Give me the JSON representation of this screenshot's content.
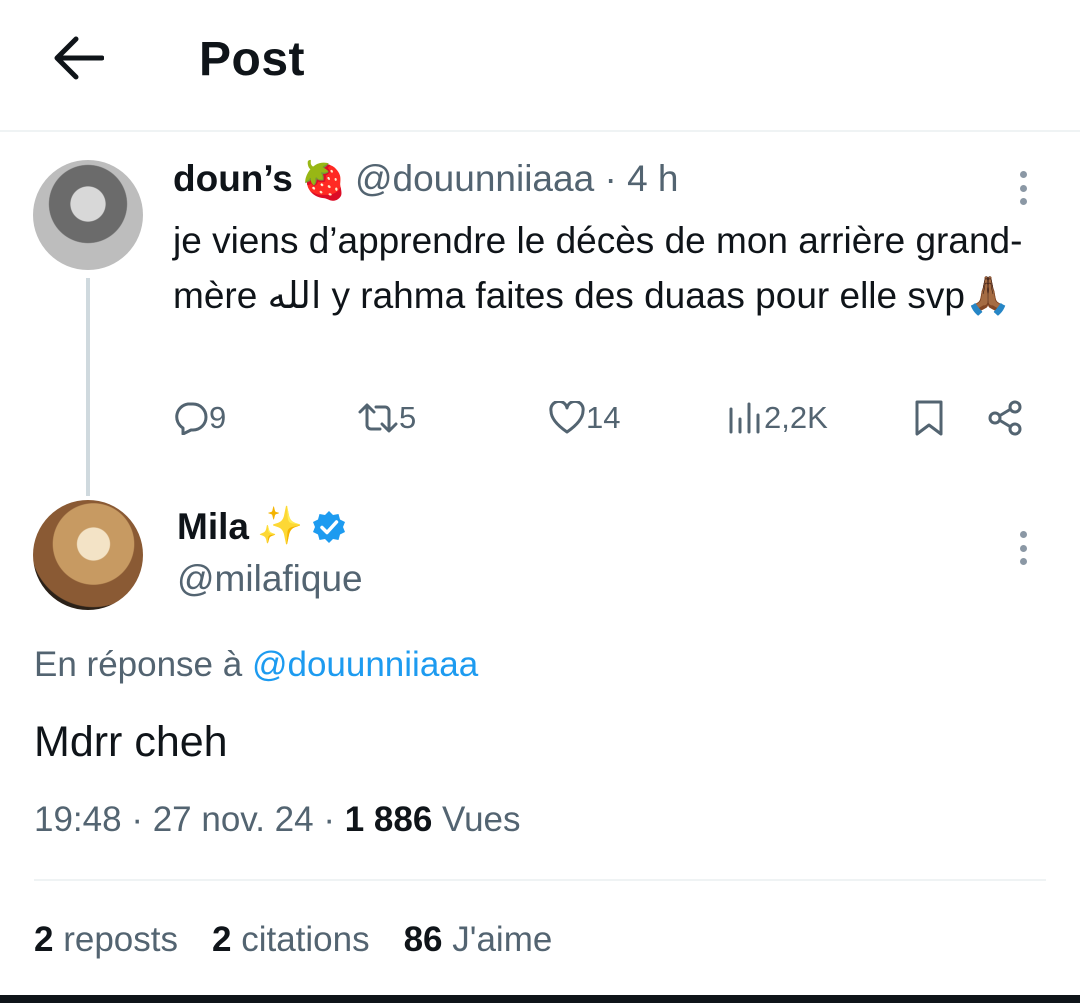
{
  "header": {
    "title": "Post",
    "back_icon": "arrow-left-icon"
  },
  "parent_post": {
    "display_name": "doun’s",
    "name_emoji": "🍓",
    "handle": "@douunniiaaa",
    "separator": "·",
    "time_ago": "4 h",
    "text": "je viens d’apprendre le décès de mon arrière grand-mère الله y rahma faites des duaas pour elle svp🙏🏾",
    "actions": {
      "replies": "9",
      "reposts": "5",
      "likes": "14",
      "views": "2,2K"
    }
  },
  "reply_post": {
    "display_name": "Mila",
    "name_emoji": "✨",
    "verified": true,
    "handle": "@milafique",
    "in_reply_prefix": "En réponse à",
    "in_reply_handle": "@douunniiaaa",
    "text": "Mdrr cheh",
    "time": "19:48",
    "date": "27 nov. 24",
    "separator": "·",
    "views_count": "1 886",
    "views_label": "Vues",
    "stats": {
      "reposts_count": "2",
      "reposts_label": "reposts",
      "quotes_count": "2",
      "quotes_label": "citations",
      "likes_count": "86",
      "likes_label": "J'aime"
    }
  },
  "colors": {
    "text_primary": "#0f1419",
    "text_secondary": "#536471",
    "accent": "#1d9bf0",
    "divider": "#eff3f4",
    "thread_line": "#cfd9de"
  }
}
